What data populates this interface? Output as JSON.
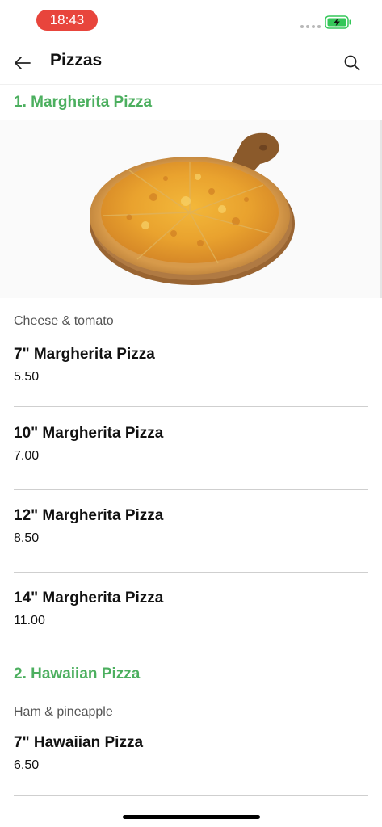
{
  "status_bar": {
    "time": "18:43",
    "time_pill_color": "#e8453c",
    "battery_color": "#34c759"
  },
  "header": {
    "title": "Pizzas",
    "back_icon": "arrow-left-icon",
    "search_icon": "search-icon"
  },
  "accent_color": "#4caf5f",
  "categories": [
    {
      "title": "1. Margherita Pizza",
      "description": "Cheese & tomato",
      "items": [
        {
          "name": "7\" Margherita Pizza",
          "price": "5.50"
        },
        {
          "name": "10\" Margherita Pizza",
          "price": "7.00"
        },
        {
          "name": "12\" Margherita Pizza",
          "price": "8.50"
        },
        {
          "name": "14\" Margherita Pizza",
          "price": "11.00"
        }
      ]
    },
    {
      "title": "2. Hawaiian Pizza",
      "description": "Ham & pineapple",
      "items": [
        {
          "name": "7\" Hawaiian Pizza",
          "price": "6.50"
        }
      ]
    }
  ]
}
